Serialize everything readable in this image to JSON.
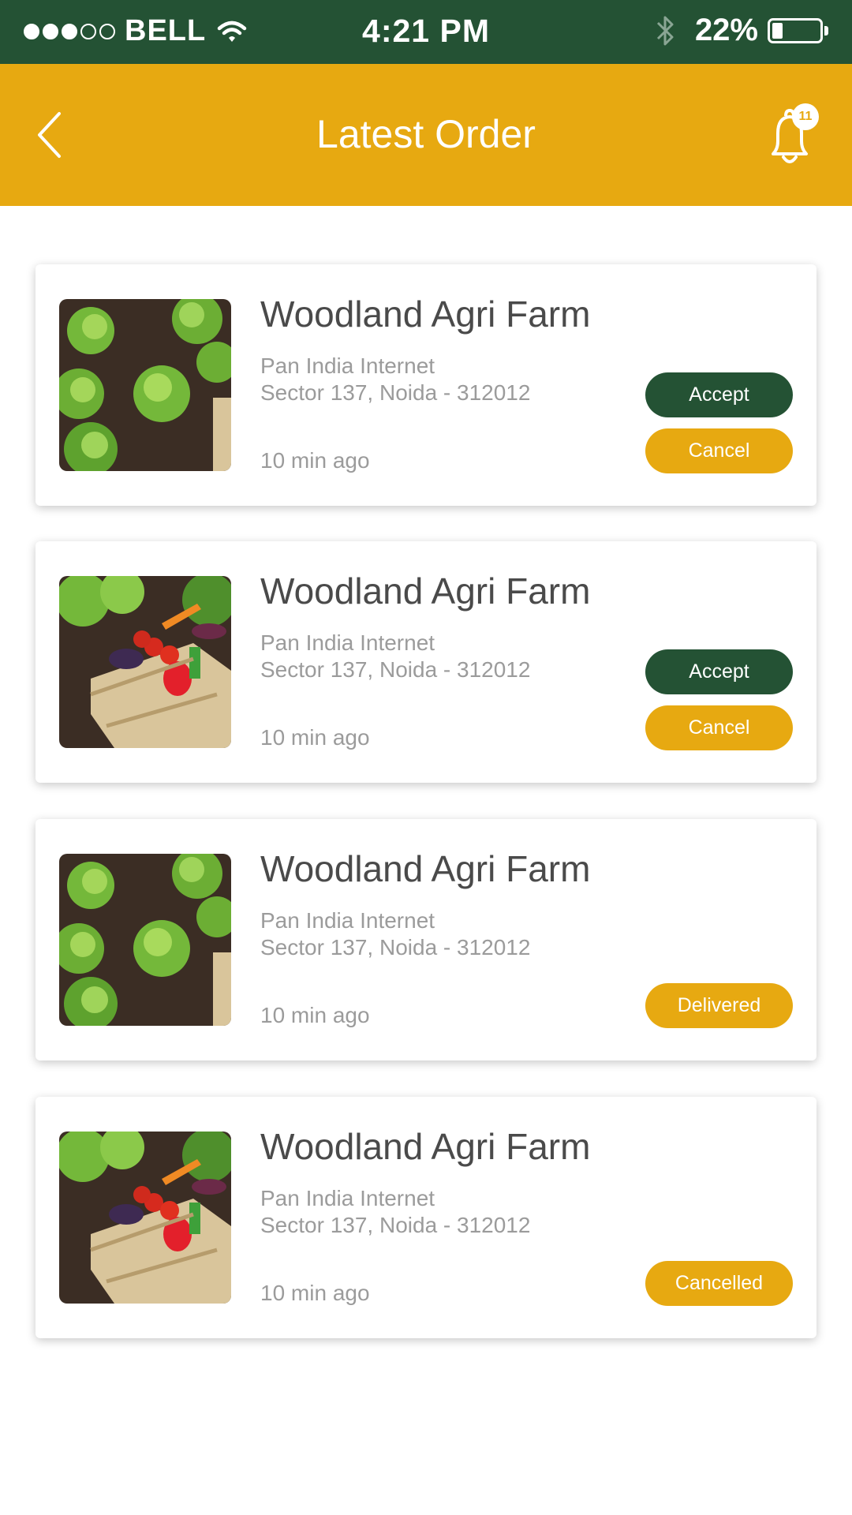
{
  "status_bar": {
    "carrier": "BELL",
    "time": "4:21 PM",
    "battery_text": "22%",
    "battery_level": 0.22,
    "signal_bars": 3,
    "signal_total": 5
  },
  "header": {
    "title": "Latest Order",
    "notification_count": "11"
  },
  "colors": {
    "primary_green": "#245234",
    "accent_yellow": "#e7a911"
  },
  "orders": [
    {
      "name": "Woodland Agri Farm",
      "address_line1": "Pan India Internet",
      "address_line2": "Sector 137, Noida - 312012",
      "time": "10 min ago",
      "image": "lettuce-field",
      "accept_label": "Accept",
      "cancel_label": "Cancel"
    },
    {
      "name": "Woodland Agri Farm",
      "address_line1": "Pan India Internet",
      "address_line2": "Sector 137, Noida - 312012",
      "time": "10 min ago",
      "image": "vegetable-crate",
      "accept_label": "Accept",
      "cancel_label": "Cancel"
    },
    {
      "name": "Woodland Agri Farm",
      "address_line1": "Pan India Internet",
      "address_line2": "Sector 137, Noida - 312012",
      "time": "10 min ago",
      "image": "lettuce-field",
      "status_label": "Delivered"
    },
    {
      "name": "Woodland Agri Farm",
      "address_line1": "Pan India Internet",
      "address_line2": "Sector 137, Noida - 312012",
      "time": "10 min ago",
      "image": "vegetable-crate",
      "status_label": "Cancelled"
    }
  ]
}
